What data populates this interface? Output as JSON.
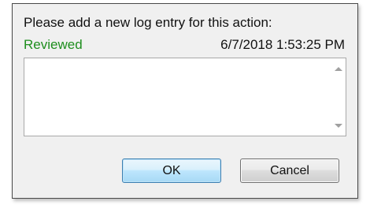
{
  "dialog": {
    "prompt": "Please add a new log entry for this action:",
    "status": "Reviewed",
    "timestamp": "6/7/2018 1:53:25 PM",
    "log_entry": {
      "value": "",
      "placeholder": ""
    },
    "ok_label": "OK",
    "cancel_label": "Cancel"
  },
  "icons": {
    "scroll_up": "scroll-up-arrow-icon",
    "scroll_down": "scroll-down-arrow-icon"
  },
  "colors": {
    "status_text": "#1e8e1e",
    "dialog_background": "#f0f0f0",
    "ok_button_border": "#3c7fb1"
  }
}
